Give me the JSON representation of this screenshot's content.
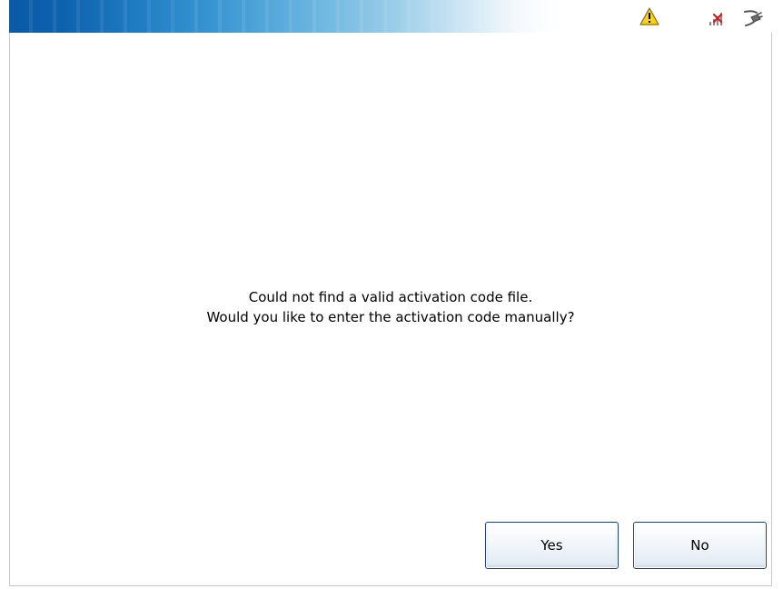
{
  "status_bar": {
    "icons": [
      "warning-icon",
      "no-signal-icon",
      "power-plug-icon"
    ],
    "accent_color": "#0a5aa6"
  },
  "dialog": {
    "message_line1": "Could not find a valid activation code file.",
    "message_line2": "Would you like to enter the activation code manually?",
    "yes_label": "Yes",
    "no_label": "No"
  }
}
